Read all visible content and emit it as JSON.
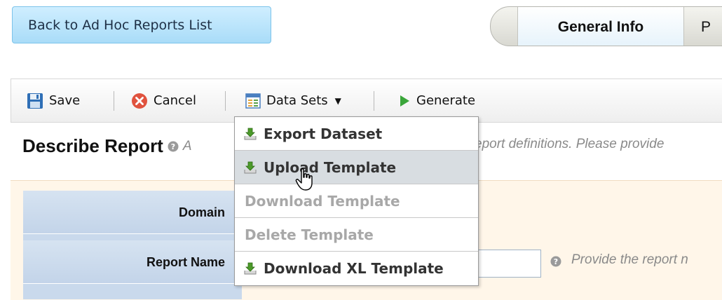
{
  "back_button": {
    "label": "Back to Ad Hoc Reports List"
  },
  "tabs": [
    {
      "label": "General Info",
      "active": true
    },
    {
      "label": "P",
      "active": false
    }
  ],
  "toolbar": {
    "save": {
      "label": "Save",
      "icon": "floppy-disk-icon"
    },
    "cancel": {
      "label": "Cancel",
      "icon": "cancel-x-icon"
    },
    "data_sets": {
      "label": "Data Sets",
      "icon": "table-icon"
    },
    "generate": {
      "label": "Generate",
      "icon": "play-icon"
    }
  },
  "section": {
    "title": "Describe Report",
    "help_prefix": "A",
    "help_text": "eport definitions. Please provide"
  },
  "dropdown": {
    "items": [
      {
        "label": "Export Dataset",
        "icon": "download-icon",
        "enabled": true
      },
      {
        "label": "Upload Template",
        "icon": "download-icon",
        "enabled": true,
        "hovered": true
      },
      {
        "label": "Download Template",
        "enabled": false
      },
      {
        "label": "Delete Template",
        "enabled": false
      },
      {
        "label": "Download XL Template",
        "icon": "download-icon",
        "enabled": true
      }
    ]
  },
  "form": {
    "domain_label": "Domain",
    "report_name_label": "Report Name",
    "report_name_value": "",
    "report_name_help": "Provide the report n"
  },
  "colors": {
    "back_button_bg": "#a9dcf8",
    "form_panel_bg": "#fff6e9",
    "label_column_bg": "#c9d9ec",
    "menu_hover_bg": "#d8dde1",
    "disabled_text": "#a8a8a8"
  }
}
